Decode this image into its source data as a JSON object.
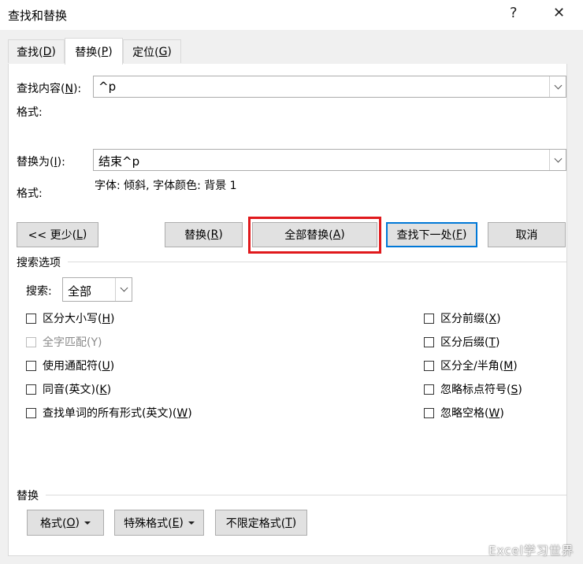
{
  "window": {
    "title": "查找和替换",
    "help": "?",
    "close": "✕"
  },
  "tabs": [
    {
      "label_pre": "查找(",
      "key": "D",
      "label_post": ")"
    },
    {
      "label_pre": "替换(",
      "key": "P",
      "label_post": ")"
    },
    {
      "label_pre": "定位(",
      "key": "G",
      "label_post": ")"
    }
  ],
  "find": {
    "label_pre": "查找内容(",
    "key": "N",
    "label_post": "):",
    "value": "^p",
    "format_label": "格式:"
  },
  "replace": {
    "label_pre": "替换为(",
    "key": "I",
    "label_post": "):",
    "value": "结束^p",
    "format_label": "格式:",
    "format_value": "字体: 倾斜, 字体颜色: 背景 1"
  },
  "buttons": {
    "less": {
      "pre": "<< 更少(",
      "key": "L",
      "post": ")"
    },
    "replace": {
      "pre": "替换(",
      "key": "R",
      "post": ")"
    },
    "replace_all": {
      "pre": "全部替换(",
      "key": "A",
      "post": ")"
    },
    "find_next": {
      "pre": "查找下一处(",
      "key": "F",
      "post": ")"
    },
    "cancel": "取消"
  },
  "search_options": {
    "heading": "搜索选项",
    "search_label": "搜索:",
    "search_value": "全部",
    "left": [
      {
        "pre": "区分大小写(",
        "key": "H",
        "post": ")",
        "checked": false,
        "disabled": false
      },
      {
        "pre": "全字匹配(",
        "key": "Y",
        "post": ")",
        "checked": false,
        "disabled": true
      },
      {
        "pre": "使用通配符(",
        "key": "U",
        "post": ")",
        "checked": false,
        "disabled": false
      },
      {
        "pre": "同音(英文)(",
        "key": "K",
        "post": ")",
        "checked": false,
        "disabled": false
      },
      {
        "pre": "查找单词的所有形式(英文)(",
        "key": "W",
        "post": ")",
        "checked": false,
        "disabled": false
      }
    ],
    "right": [
      {
        "pre": "区分前缀(",
        "key": "X",
        "post": ")",
        "checked": false
      },
      {
        "pre": "区分后缀(",
        "key": "T",
        "post": ")",
        "checked": false
      },
      {
        "pre": "区分全/半角(",
        "key": "M",
        "post": ")",
        "checked": false
      },
      {
        "pre": "忽略标点符号(",
        "key": "S",
        "post": ")",
        "checked": false
      },
      {
        "pre": "忽略空格(",
        "key": "W",
        "post": ")",
        "checked": false
      }
    ]
  },
  "replace_section": {
    "heading": "替换",
    "format_btn": {
      "pre": "格式(",
      "key": "O",
      "post": ")"
    },
    "special_btn": {
      "pre": "特殊格式(",
      "key": "E",
      "post": ")"
    },
    "no_format_btn": {
      "pre": "不限定格式(",
      "key": "T",
      "post": ")"
    }
  },
  "watermark": "Excel学习世界",
  "colors": {
    "highlight_box": "#e0191c",
    "default_button_border": "#0078d7"
  }
}
